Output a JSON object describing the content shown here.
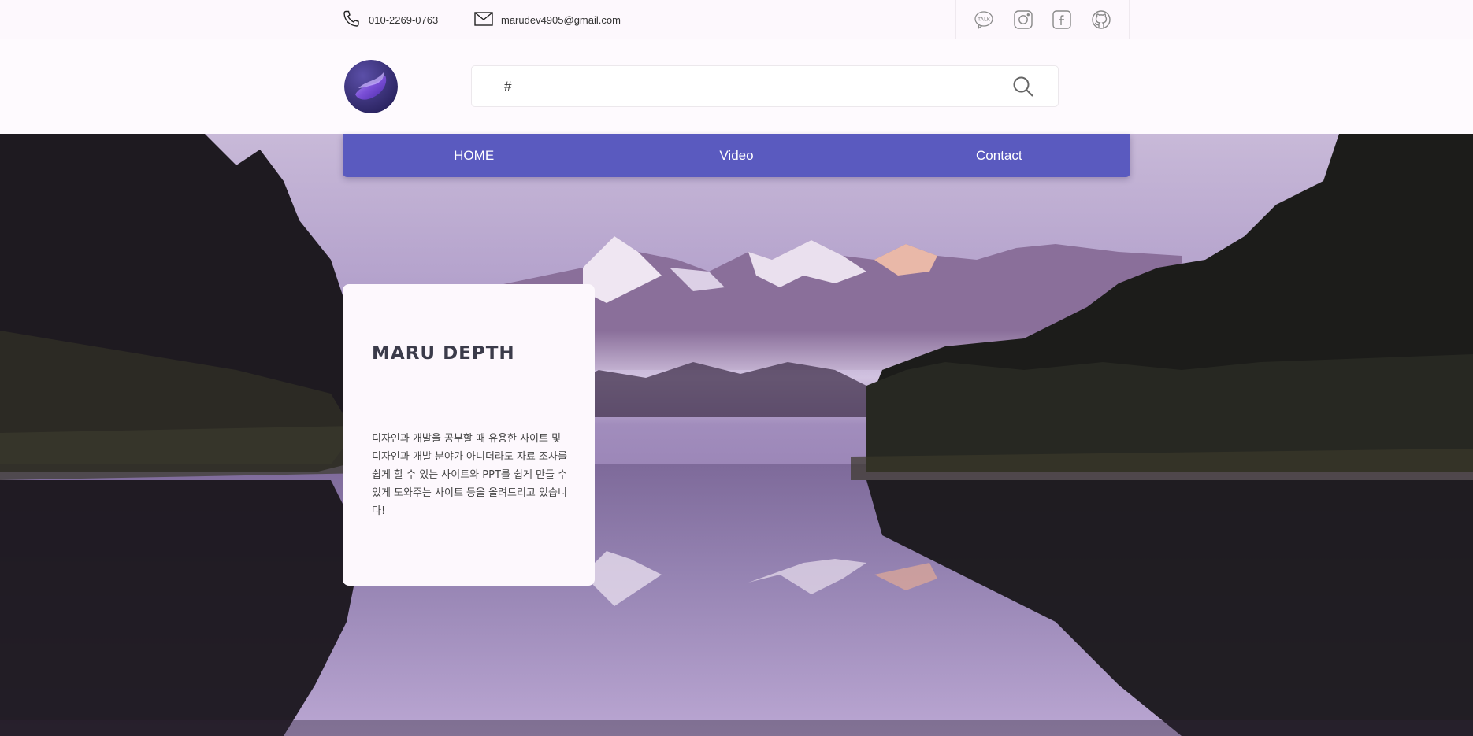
{
  "topbar": {
    "phone": "010-2269-0763",
    "email": "marudev4905@gmail.com",
    "social": [
      {
        "name": "kakaotalk",
        "icon": "kakaotalk-icon"
      },
      {
        "name": "instagram",
        "icon": "instagram-icon"
      },
      {
        "name": "facebook",
        "icon": "facebook-icon"
      },
      {
        "name": "github",
        "icon": "github-icon"
      }
    ]
  },
  "header": {
    "logo": "logo-icon",
    "search": {
      "value": "#",
      "icon": "search-icon"
    }
  },
  "nav": {
    "items": [
      {
        "label": "HOME"
      },
      {
        "label": "Video"
      },
      {
        "label": "Contact"
      }
    ]
  },
  "card": {
    "title": "MARU DEPTH",
    "text": "디자인과 개발을 공부할 때 유용한 사이트 및 디자인과 개발 분야가 아니더라도 자료 조사를 쉽게 할 수 있는 사이트와 PPT를 쉽게 만들 수 있게 도와주는 사이트 등을 올려드리고 있습니다!"
  },
  "colors": {
    "accent": "#5a5abf",
    "background": "#fefafe",
    "text": "#3b3b4a"
  }
}
